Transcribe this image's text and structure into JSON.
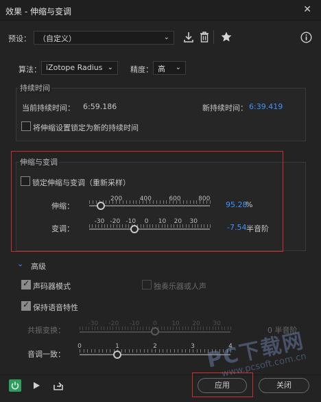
{
  "window": {
    "title": "效果 - 伸缩与变调",
    "close_glyph": "✕"
  },
  "preset": {
    "label": "预设：",
    "value": "（自定义）"
  },
  "algorithm": {
    "label": "算法：",
    "value": "iZotope Radius",
    "precision_label": "精度：",
    "precision_value": "高"
  },
  "duration": {
    "group_title": "持续时间",
    "current_label": "当前持续时间：",
    "current_value": "6:59.186",
    "new_label": "新持续时间：",
    "new_value": "6:39.419",
    "lock_label": "将伸缩设置锁定为新的持续时间"
  },
  "stretch_pitch": {
    "group_title": "伸缩与变调",
    "lock_label": "锁定伸缩与变调（重新采样）",
    "stretch_label": "伸缩：",
    "stretch_value": "95.28",
    "stretch_unit": "%",
    "stretch_scale": [
      "200",
      "400",
      "600",
      "800"
    ],
    "stretch_level": 95.28,
    "pitch_label": "变调：",
    "pitch_value": "-7.54",
    "pitch_unit": "半音阶",
    "pitch_scale": [
      "-30",
      "-20",
      "-10",
      "0",
      "10",
      "20",
      "30"
    ],
    "pitch_level": -7.54
  },
  "advanced": {
    "title": "高级",
    "vocoder_label": "声码器模式",
    "solo_label": "独奏乐器或人声",
    "preserve_label": "保持语音特性",
    "formant_label": "共振变换：",
    "formant_scale": [
      "-30",
      "-20",
      "-10",
      "0",
      "10",
      "20",
      "30"
    ],
    "formant_value": "0 半音阶",
    "pitch_coherence_label": "音调一致：",
    "coherence_scale": [
      "0",
      "1",
      "2",
      "3",
      "4"
    ],
    "coherence_level": 1
  },
  "footer": {
    "apply_label": "应用",
    "close_label": "关闭"
  },
  "watermark": {
    "line1": "PC下载网",
    "line2": "www.pcsoft.com.cn"
  },
  "colors": {
    "accent_blue": "#3f94ff",
    "power_green": "#2f9e5c",
    "highlight_red": "#d22d2d"
  }
}
